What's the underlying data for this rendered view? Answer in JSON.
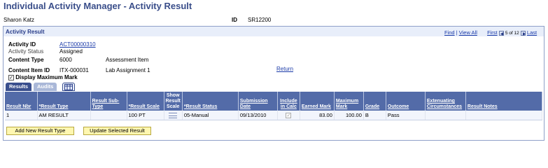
{
  "page": {
    "title": "Individual Activity Manager - Activity Result",
    "student_name": "Sharon Katz",
    "id_label": "ID",
    "id_value": "SR12200"
  },
  "section": {
    "title": "Activity Result",
    "nav": {
      "find": "Find",
      "view_all": "View All",
      "first": "First",
      "position": "5 of 12",
      "last": "Last"
    }
  },
  "fields": {
    "activity_id_label": "Activity ID",
    "activity_id_value": "ACT00000310",
    "activity_status_label": "Activity Status",
    "activity_status_value": "Assigned",
    "content_type_label": "Content Type",
    "content_type_value": "6000",
    "content_type_desc": "Assessment Item",
    "content_item_id_label": "Content Item ID",
    "content_item_id_value": "ITX-000031",
    "content_item_desc": "Lab Assignment 1",
    "return_link": "Return",
    "display_max_mark_label": "Display Maximum Mark",
    "display_max_mark_checked": true
  },
  "tabs": {
    "results": "Results",
    "audits": "Audits"
  },
  "grid": {
    "columns": [
      "Result Nbr",
      "*Result Type",
      "Result Sub-Type",
      "*Result Scale",
      "Show Result Scale",
      "*Result Status",
      "Submission Date",
      "Include in Calc",
      "Earned Mark",
      "Maximum Mark",
      "Grade",
      "Outcome",
      "Extenuating Circumstances",
      "Result Notes"
    ],
    "rows": [
      {
        "result_nbr": "1",
        "result_type": "AM RESULT",
        "result_sub_type": "",
        "result_scale": "100 PT",
        "result_status": "05-Manual",
        "submission_date": "09/13/2010",
        "include_in_calc": true,
        "earned_mark": "83.00",
        "maximum_mark": "100.00",
        "grade": "B",
        "outcome": "Pass",
        "extenuating": "",
        "notes": ""
      }
    ]
  },
  "buttons": {
    "add_new_result_type": "Add New Result Type",
    "update_selected_result": "Update Selected Result"
  }
}
